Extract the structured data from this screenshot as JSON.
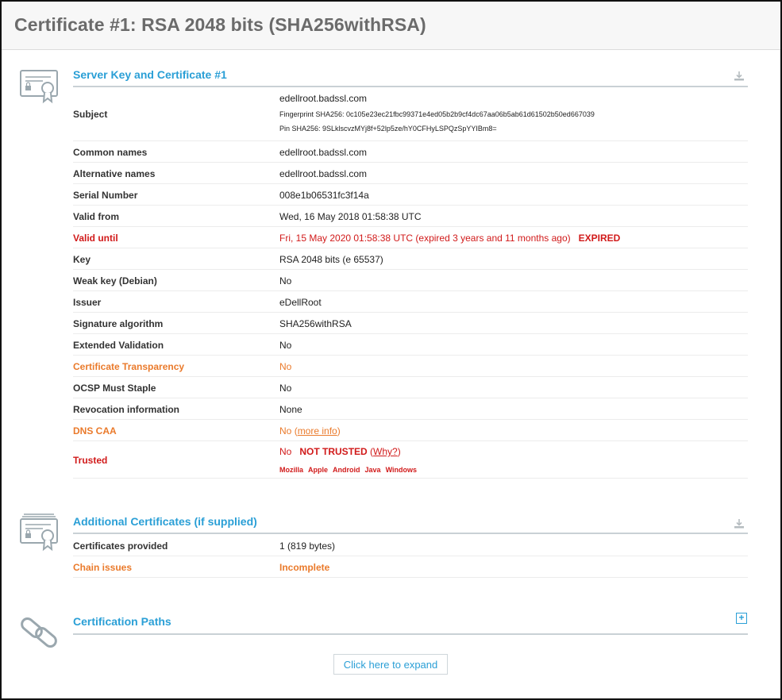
{
  "page_title": "Certificate #1: RSA 2048 bits (SHA256withRSA)",
  "server_key": {
    "title": "Server Key and Certificate #1",
    "subject": {
      "label": "Subject",
      "value": "edellroot.badssl.com",
      "fingerprint": "Fingerprint SHA256: 0c105e23ec21fbc99371e4ed05b2b9cf4dc67aa06b5ab61d61502b50ed667039",
      "pin": "Pin SHA256: 9SLklscvzMYj8f+52lp5ze/hY0CFHyLSPQzSpYYIBm8="
    },
    "rows": [
      {
        "label": "Common names",
        "value": "edellroot.badssl.com"
      },
      {
        "label": "Alternative names",
        "value": "edellroot.badssl.com"
      },
      {
        "label": "Serial Number",
        "value": "008e1b06531fc3f14a"
      },
      {
        "label": "Valid from",
        "value": "Wed, 16 May 2018 01:58:38 UTC"
      }
    ],
    "valid_until": {
      "label": "Valid until",
      "value": "Fri, 15 May 2020 01:58:38 UTC (expired 3 years and 11 months ago)",
      "badge": "EXPIRED"
    },
    "rows2": [
      {
        "label": "Key",
        "value": "RSA 2048 bits (e 65537)"
      },
      {
        "label": "Weak key (Debian)",
        "value": "No"
      },
      {
        "label": "Issuer",
        "value": "eDellRoot"
      },
      {
        "label": "Signature algorithm",
        "value": "SHA256withRSA"
      },
      {
        "label": "Extended Validation",
        "value": "No"
      }
    ],
    "cert_transparency": {
      "label": "Certificate Transparency",
      "value": "No"
    },
    "rows3": [
      {
        "label": "OCSP Must Staple",
        "value": "No"
      },
      {
        "label": "Revocation information",
        "value": "None"
      }
    ],
    "dns_caa": {
      "label": "DNS CAA",
      "value": "No",
      "link_open": "(",
      "link": "more info",
      "link_close": ")"
    },
    "trusted": {
      "label": "Trusted",
      "value": "No",
      "status": "NOT TRUSTED",
      "why_open": "(",
      "why": "Why?",
      "why_close": ")",
      "stores": [
        "Mozilla",
        "Apple",
        "Android",
        "Java",
        "Windows"
      ]
    }
  },
  "additional": {
    "title": "Additional Certificates (if supplied)",
    "rows": [
      {
        "label": "Certificates provided",
        "value": "1 (819 bytes)"
      },
      {
        "label": "Chain issues",
        "value": "Incomplete"
      }
    ]
  },
  "paths": {
    "title": "Certification Paths",
    "plus": "+",
    "expand_label": "Click here to expand"
  },
  "colors": {
    "accent": "#2a9fd6",
    "error": "#d11a1a",
    "warning": "#ea7a2b",
    "title_gray": "#6b6b6b"
  }
}
